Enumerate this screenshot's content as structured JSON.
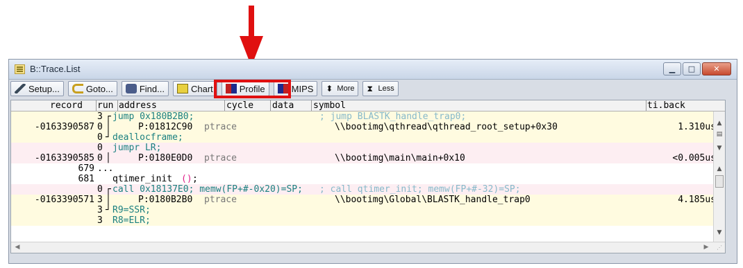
{
  "window": {
    "title": "B::Trace.List",
    "controls": [
      "minimize-icon",
      "maximize-icon",
      "close-icon"
    ]
  },
  "toolbar": {
    "setup_label": "Setup...",
    "goto_label": "Goto...",
    "find_label": "Find...",
    "chart_label": "Chart",
    "profile_label": "Profile",
    "mips_label": "MIPS",
    "more_label": "More",
    "less_label": "Less"
  },
  "annotation_color": "#e01010",
  "table": {
    "headers": {
      "record": "record",
      "run": "run",
      "address": "address",
      "cycle": "cycle",
      "data": "data",
      "symbol": "symbol",
      "ti_back": "ti.back"
    },
    "rows": {
      "r1_run": "3",
      "r1_asm": "jump 0x180B2B0;",
      "r1_comment": "; jump BLASTK_handle_trap0;",
      "r2_record": "-0163390587",
      "r2_run": "0",
      "r2_addr": "P:01812C90",
      "r2_cycle": "ptrace",
      "r2_symbol": "\\\\bootimg\\qthread\\qthread_root_setup+0x30",
      "r2_ti": "1.310us",
      "r3_run": "0",
      "r3_asm": "deallocframe;",
      "r4_run": "0",
      "r4_asm": "jumpr LR;",
      "r5_record": "-0163390585",
      "r5_run": "0",
      "r5_addr": "P:0180E0D0",
      "r5_cycle": "ptrace",
      "r5_symbol": "\\\\bootimg\\main\\main+0x10",
      "r5_ti": "<0.005us",
      "r6_record": "679",
      "r6_run": "...",
      "r7_record": "681",
      "r7_src_a": "qtimer_init",
      "r7_src_b": "()",
      "r7_src_c": ";",
      "r8_run": "0",
      "r8_asm": "call 0x18137E0; memw(FP+#-0x20)=SP;",
      "r8_comment": "; call qtimer_init; memw(FP+#-32)=SP;",
      "r9_record": "-0163390571",
      "r9_run": "3",
      "r9_addr": "P:0180B2B0",
      "r9_cycle": "ptrace",
      "r9_symbol": "\\\\bootimg\\Global\\BLASTK_handle_trap0",
      "r9_ti": "4.185us",
      "r10_run": "3",
      "r10_asm": "R9=SSR;",
      "r11_run": "3",
      "r11_asm": "R8=ELR;"
    }
  }
}
